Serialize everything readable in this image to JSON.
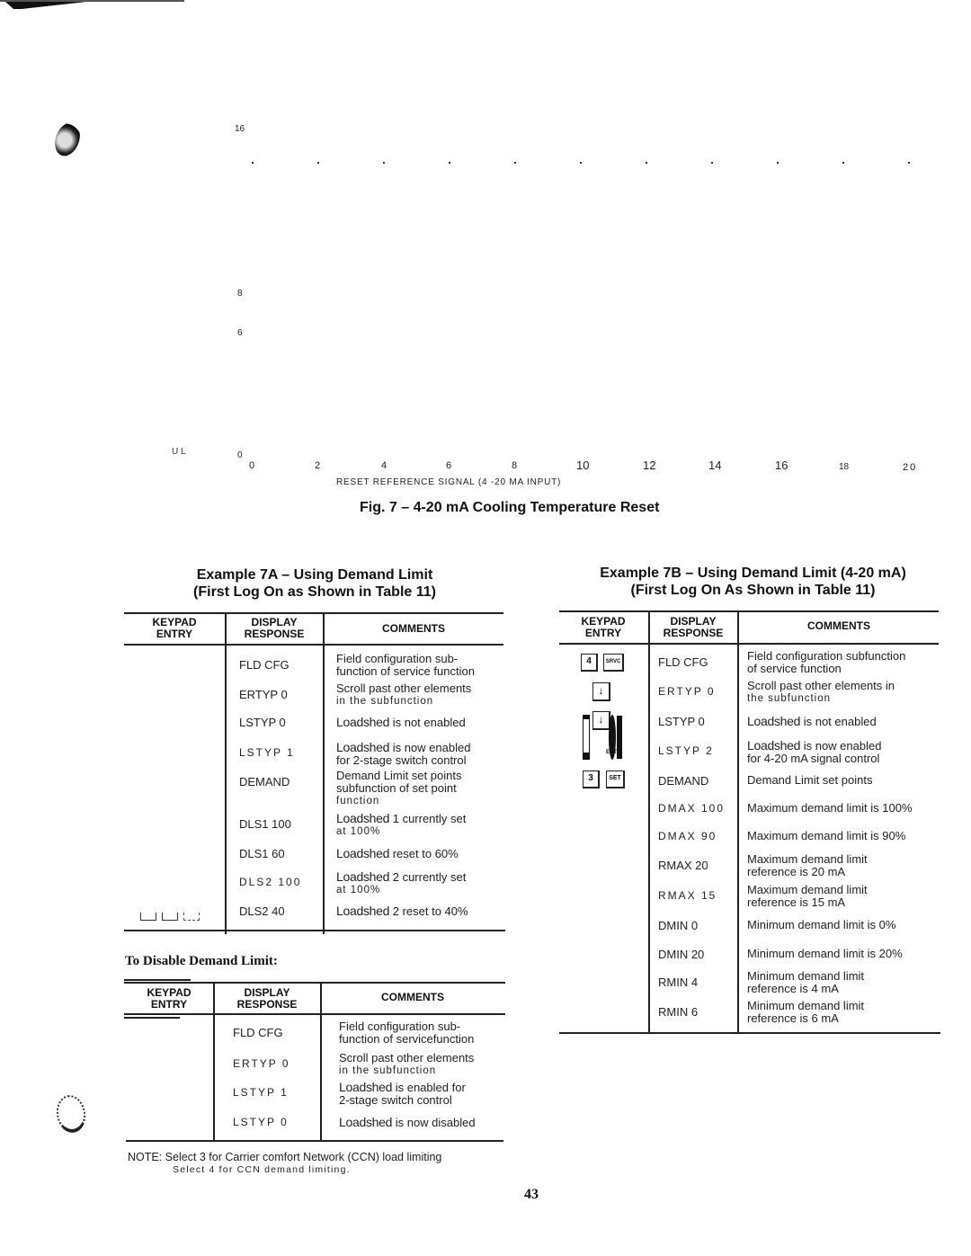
{
  "chart": {
    "y_ticks": [
      "16",
      "8",
      "6",
      "0"
    ],
    "x_ticks": [
      "0",
      "2",
      "4",
      "6",
      "8",
      "10",
      "12",
      "14",
      "16",
      "18",
      "20"
    ],
    "x_axis_title": "RESET REFERENCE SIGNAL (4 -20 MA INPUT)",
    "stray_label": "U L",
    "caption": "Fig. 7 – 4-20 mA Cooling Temperature Reset"
  },
  "example7a": {
    "title_line1": "Example 7A – Using Demand Limit",
    "title_line2": "(First Log On as Shown in Table 11)",
    "headers": {
      "keypad": "KEYPAD\nENTRY",
      "display": "DISPLAY\nRESPONSE",
      "comments": "COMMENTS"
    },
    "rows": [
      {
        "display": "FLD CFG",
        "comment_a": "Field configuration sub-",
        "comment_b": "function of service function"
      },
      {
        "display": "ERTYP 0",
        "comment_a": "Scroll past other elements",
        "comment_b": "in the subfunction"
      },
      {
        "display": "LSTYP 0",
        "comment_bold": "Loadshed",
        "comment_a": " is not enabled"
      },
      {
        "display": "LSTYP 1",
        "comment_bold": "Loadshed",
        "comment_a": " is now enabled",
        "comment_b": "for 2-stage switch control"
      },
      {
        "display": "DEMAND",
        "comment_a": "Demand Limit set points",
        "comment_b": "subfunction of set point",
        "comment_c": "function"
      },
      {
        "display": "DLS1 100",
        "comment_bold": "Loadshed",
        "comment_a": " 1 currently set",
        "comment_b": "at 100%"
      },
      {
        "display": "DLS1 60",
        "comment_bold": "Loadshed",
        "comment_a": " reset to 60%"
      },
      {
        "display": "DLS2 100",
        "comment_bold": "Loadshed",
        "comment_a": " 2 currently set",
        "comment_b": "at 100%"
      },
      {
        "display": "DLS2 40",
        "comment_bold": "Loadshed",
        "comment_a": " 2 reset to 40%"
      }
    ]
  },
  "disable": {
    "heading": "To Disable Demand Limit:",
    "headers": {
      "keypad": "KEYPAD\nENTRY",
      "display": "DISPLAY\nRESPONSE",
      "comments": "COMMENTS"
    },
    "rows": [
      {
        "display": "FLD CFG",
        "comment_a": "Field configuration sub-",
        "comment_b": "function of servicefunction"
      },
      {
        "display": "ERTYP 0",
        "comment_a": "Scroll past other elements",
        "comment_b": "in the subfunction"
      },
      {
        "display": "LSTYP 1",
        "comment_bold": "Loadshed",
        "comment_a": " is enabled for",
        "comment_b": "2-stage switch control"
      },
      {
        "display": "LSTYP 0",
        "comment_bold": "Loadshed",
        "comment_a": " is now disabled"
      }
    ],
    "note_line1": "NOTE: Select 3 for Carrier comfort Network (CCN) load limiting",
    "note_line2": "Select 4 for CCN demand limiting."
  },
  "example7b": {
    "title_line1": "Example 7B – Using Demand Limit (4-20 mA)",
    "title_line2": "(First Log On As Shown in Table 11)",
    "headers": {
      "keypad": "KEYPAD\nENTRY",
      "display": "DISPLAY\nRESPONSE",
      "comments": "COMMENTS"
    },
    "keys": {
      "k4": "4",
      "srvc": "SRVC",
      "down": "↓",
      "enter": "ENTR",
      "k3": "3",
      "set": "SET"
    },
    "rows": [
      {
        "display": "FLD CFG",
        "comment_a": "Field configuration subfunction",
        "comment_b": "of service function"
      },
      {
        "display": "ERTYP 0",
        "comment_a": "Scroll past other elements in",
        "comment_b": "the subfunction"
      },
      {
        "display": "LSTYP 0",
        "comment_bold": "Loadshed",
        "comment_a": " is not enabled"
      },
      {
        "display": "LSTYP 2",
        "comment_bold": "Loadshed",
        "comment_a": " is now enabled",
        "comment_b": "for 4-20 mA signal control"
      },
      {
        "display": "DEMAND",
        "comment_a": "Demand Limit set points"
      },
      {
        "display": "DMAX 100",
        "comment_a": "Maximum demand limit is 100%"
      },
      {
        "display": "DMAX 90",
        "comment_a": "Maximum demand limit is 90%"
      },
      {
        "display": "RMAX 20",
        "comment_a": "Maximum demand limit",
        "comment_b": "reference is 20 mA"
      },
      {
        "display": "RMAX 15",
        "comment_a": "Maximum demand limit",
        "comment_b": "reference is 15 mA"
      },
      {
        "display": "DMIN 0",
        "comment_a": "Minimum demand limit is 0%"
      },
      {
        "display": "DMIN 20",
        "comment_a": "Minimum demand limit is 20%"
      },
      {
        "display": "RMIN 4",
        "comment_a": "Minimum demand limit",
        "comment_b": "reference is 4 mA"
      },
      {
        "display": "RMIN 6",
        "comment_a": "Minimum demand limit",
        "comment_b": "reference is 6 mA"
      }
    ]
  },
  "page_number": "43"
}
